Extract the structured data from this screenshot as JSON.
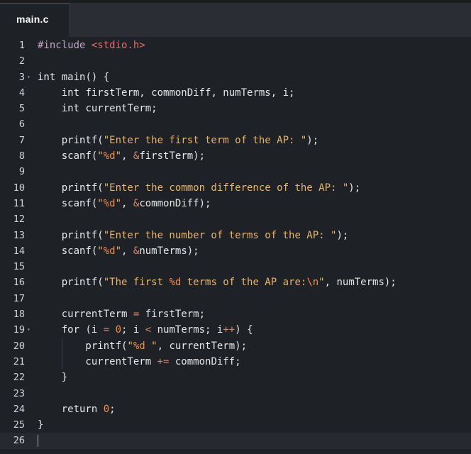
{
  "tab": {
    "label": "main.c"
  },
  "colors": {
    "background": "#1e2126",
    "tab_bar": "#2a2d34",
    "string": "#e8b56a",
    "format_specifier": "#f08d49",
    "include_path": "#e0706b",
    "number": "#f08d49"
  },
  "lines": [
    {
      "n": "1",
      "fold": "",
      "indent": 0,
      "tokens": [
        [
          "pre",
          "#include "
        ],
        [
          "inc",
          "<stdio.h>"
        ]
      ]
    },
    {
      "n": "2",
      "fold": "",
      "indent": 0,
      "tokens": []
    },
    {
      "n": "3",
      "fold": "▾",
      "indent": 0,
      "tokens": [
        [
          "kw",
          "int"
        ],
        [
          "id",
          " main() {"
        ]
      ]
    },
    {
      "n": "4",
      "fold": "",
      "indent": 1,
      "tokens": [
        [
          "kw",
          "    int"
        ],
        [
          "id",
          " firstTerm, commonDiff, numTerms, i;"
        ]
      ]
    },
    {
      "n": "5",
      "fold": "",
      "indent": 1,
      "tokens": [
        [
          "kw",
          "    int"
        ],
        [
          "id",
          " currentTerm;"
        ]
      ]
    },
    {
      "n": "6",
      "fold": "",
      "indent": 1,
      "tokens": []
    },
    {
      "n": "7",
      "fold": "",
      "indent": 1,
      "tokens": [
        [
          "fn",
          "    printf("
        ],
        [
          "str",
          "\"Enter the first term of the AP: \""
        ],
        [
          "punc",
          ");"
        ]
      ]
    },
    {
      "n": "8",
      "fold": "",
      "indent": 1,
      "tokens": [
        [
          "fn",
          "    scanf("
        ],
        [
          "str",
          "\""
        ],
        [
          "fmt",
          "%d"
        ],
        [
          "str",
          "\""
        ],
        [
          "punc",
          ", "
        ],
        [
          "op",
          "&"
        ],
        [
          "id",
          "firstTerm);"
        ]
      ]
    },
    {
      "n": "9",
      "fold": "",
      "indent": 1,
      "tokens": []
    },
    {
      "n": "10",
      "fold": "",
      "indent": 1,
      "tokens": [
        [
          "fn",
          "    printf("
        ],
        [
          "str",
          "\"Enter the common difference of the AP: \""
        ],
        [
          "punc",
          ");"
        ]
      ]
    },
    {
      "n": "11",
      "fold": "",
      "indent": 1,
      "tokens": [
        [
          "fn",
          "    scanf("
        ],
        [
          "str",
          "\""
        ],
        [
          "fmt",
          "%d"
        ],
        [
          "str",
          "\""
        ],
        [
          "punc",
          ", "
        ],
        [
          "op",
          "&"
        ],
        [
          "id",
          "commonDiff);"
        ]
      ]
    },
    {
      "n": "12",
      "fold": "",
      "indent": 1,
      "tokens": []
    },
    {
      "n": "13",
      "fold": "",
      "indent": 1,
      "tokens": [
        [
          "fn",
          "    printf("
        ],
        [
          "str",
          "\"Enter the number of terms of the AP: \""
        ],
        [
          "punc",
          ");"
        ]
      ]
    },
    {
      "n": "14",
      "fold": "",
      "indent": 1,
      "tokens": [
        [
          "fn",
          "    scanf("
        ],
        [
          "str",
          "\""
        ],
        [
          "fmt",
          "%d"
        ],
        [
          "str",
          "\""
        ],
        [
          "punc",
          ", "
        ],
        [
          "op",
          "&"
        ],
        [
          "id",
          "numTerms);"
        ]
      ]
    },
    {
      "n": "15",
      "fold": "",
      "indent": 1,
      "tokens": []
    },
    {
      "n": "16",
      "fold": "",
      "indent": 1,
      "tokens": [
        [
          "fn",
          "    printf("
        ],
        [
          "str",
          "\"The first "
        ],
        [
          "fmt",
          "%d"
        ],
        [
          "str",
          " terms of the AP are:"
        ],
        [
          "esc",
          "\\n"
        ],
        [
          "str",
          "\""
        ],
        [
          "punc",
          ", "
        ],
        [
          "id",
          "numTerms);"
        ]
      ]
    },
    {
      "n": "17",
      "fold": "",
      "indent": 1,
      "tokens": []
    },
    {
      "n": "18",
      "fold": "",
      "indent": 1,
      "tokens": [
        [
          "id",
          "    currentTerm "
        ],
        [
          "op",
          "="
        ],
        [
          "id",
          " firstTerm;"
        ]
      ]
    },
    {
      "n": "19",
      "fold": "▾",
      "indent": 1,
      "tokens": [
        [
          "kw",
          "    for"
        ],
        [
          "id",
          " (i "
        ],
        [
          "op",
          "="
        ],
        [
          "id",
          " "
        ],
        [
          "num",
          "0"
        ],
        [
          "id",
          "; i "
        ],
        [
          "op",
          "<"
        ],
        [
          "id",
          " numTerms; i"
        ],
        [
          "op",
          "++"
        ],
        [
          "id",
          ") {"
        ]
      ]
    },
    {
      "n": "20",
      "fold": "",
      "indent": 2,
      "tokens": [
        [
          "fn",
          "        printf("
        ],
        [
          "str",
          "\""
        ],
        [
          "fmt",
          "%d"
        ],
        [
          "str",
          " \""
        ],
        [
          "punc",
          ", "
        ],
        [
          "id",
          "currentTerm);"
        ]
      ]
    },
    {
      "n": "21",
      "fold": "",
      "indent": 2,
      "tokens": [
        [
          "id",
          "        currentTerm "
        ],
        [
          "op",
          "+="
        ],
        [
          "id",
          " commonDiff;"
        ]
      ]
    },
    {
      "n": "22",
      "fold": "",
      "indent": 1,
      "tokens": [
        [
          "punc",
          "    }"
        ]
      ]
    },
    {
      "n": "23",
      "fold": "",
      "indent": 1,
      "tokens": []
    },
    {
      "n": "24",
      "fold": "",
      "indent": 1,
      "tokens": [
        [
          "kw",
          "    return"
        ],
        [
          "id",
          " "
        ],
        [
          "num",
          "0"
        ],
        [
          "punc",
          ";"
        ]
      ]
    },
    {
      "n": "25",
      "fold": "",
      "indent": 0,
      "tokens": [
        [
          "punc",
          "}"
        ]
      ]
    },
    {
      "n": "26",
      "fold": "",
      "indent": 0,
      "tokens": [],
      "active": true
    }
  ]
}
